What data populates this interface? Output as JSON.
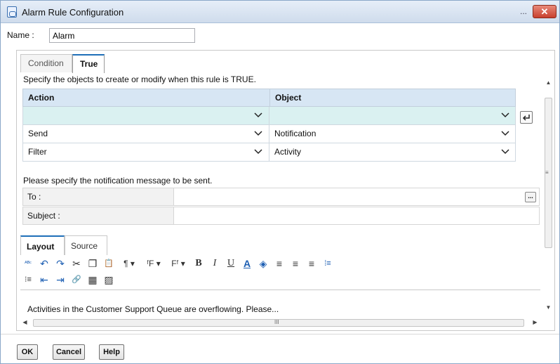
{
  "window": {
    "title": "Alarm Rule Configuration",
    "minimize_glyph": "...",
    "close_glyph": "✕",
    "close_color": "#c8402e"
  },
  "name_field": {
    "label": "Name :",
    "value": "Alarm"
  },
  "tabs": [
    {
      "label": "Condition",
      "active": false
    },
    {
      "label": "True",
      "active": true
    }
  ],
  "instruction": "Specify the objects to create or modify when this rule is TRUE.",
  "actions_grid": {
    "columns": [
      "Action",
      "Object"
    ],
    "rows": [
      {
        "action": "",
        "object": "",
        "selected": true
      },
      {
        "action": "Send",
        "object": "Notification",
        "selected": false
      },
      {
        "action": "Filter",
        "object": "Activity",
        "selected": false
      }
    ]
  },
  "notification": {
    "prompt": "Please specify the notification message to be sent.",
    "to_label": "To :",
    "to_value": "",
    "subject_label": "Subject :",
    "subject_value": "",
    "browse_glyph": "..."
  },
  "editor": {
    "tabs": [
      {
        "label": "Layout",
        "active": true
      },
      {
        "label": "Source",
        "active": false
      }
    ],
    "toolbar_row1": [
      {
        "icon": "spellcheck-icon",
        "glyph": "ᴬᴮᶜ"
      },
      {
        "icon": "undo-icon",
        "glyph": "↶"
      },
      {
        "icon": "redo-icon",
        "glyph": "↷"
      },
      {
        "icon": "cut-icon",
        "glyph": "✂"
      },
      {
        "icon": "copy-icon",
        "glyph": "❐"
      },
      {
        "icon": "paste-icon",
        "glyph": "📋"
      },
      {
        "icon": "paragraph-format-icon",
        "glyph": "¶ ▾"
      },
      {
        "icon": "font-family-icon",
        "glyph": "ᶠF ▾"
      },
      {
        "icon": "font-size-icon",
        "glyph": "Fᶠ ▾"
      },
      {
        "icon": "bold-icon",
        "glyph": "B"
      },
      {
        "icon": "italic-icon",
        "glyph": "I"
      },
      {
        "icon": "underline-icon",
        "glyph": "U"
      },
      {
        "icon": "font-color-icon",
        "glyph": "A"
      },
      {
        "icon": "highlight-icon",
        "glyph": "◈"
      },
      {
        "icon": "align-left-icon",
        "glyph": "≡"
      },
      {
        "icon": "align-center-icon",
        "glyph": "≡"
      },
      {
        "icon": "align-right-icon",
        "glyph": "≡"
      },
      {
        "icon": "numbered-list-icon",
        "glyph": "⁞≡"
      }
    ],
    "toolbar_row2": [
      {
        "icon": "bulleted-list-icon",
        "glyph": "⁝≡"
      },
      {
        "icon": "outdent-icon",
        "glyph": "⇤"
      },
      {
        "icon": "indent-icon",
        "glyph": "⇥"
      },
      {
        "icon": "insert-link-icon",
        "glyph": "🔗"
      },
      {
        "icon": "insert-table-icon",
        "glyph": "▦"
      },
      {
        "icon": "insert-image-icon",
        "glyph": "▨"
      }
    ],
    "body_text": "Activities in the Customer Support Queue are overflowing.  Please..."
  },
  "scrollbars": {
    "grip_v": "≡",
    "grip_h": "III",
    "up": "▲",
    "down": "▼",
    "left": "◀",
    "right": "▶"
  },
  "buttons": {
    "ok": "OK",
    "cancel": "Cancel",
    "help": "Help"
  },
  "colors": {
    "header_bg": "#d7e6f4",
    "selected_row": "#daf1f1",
    "accent": "#1e6fb8"
  }
}
